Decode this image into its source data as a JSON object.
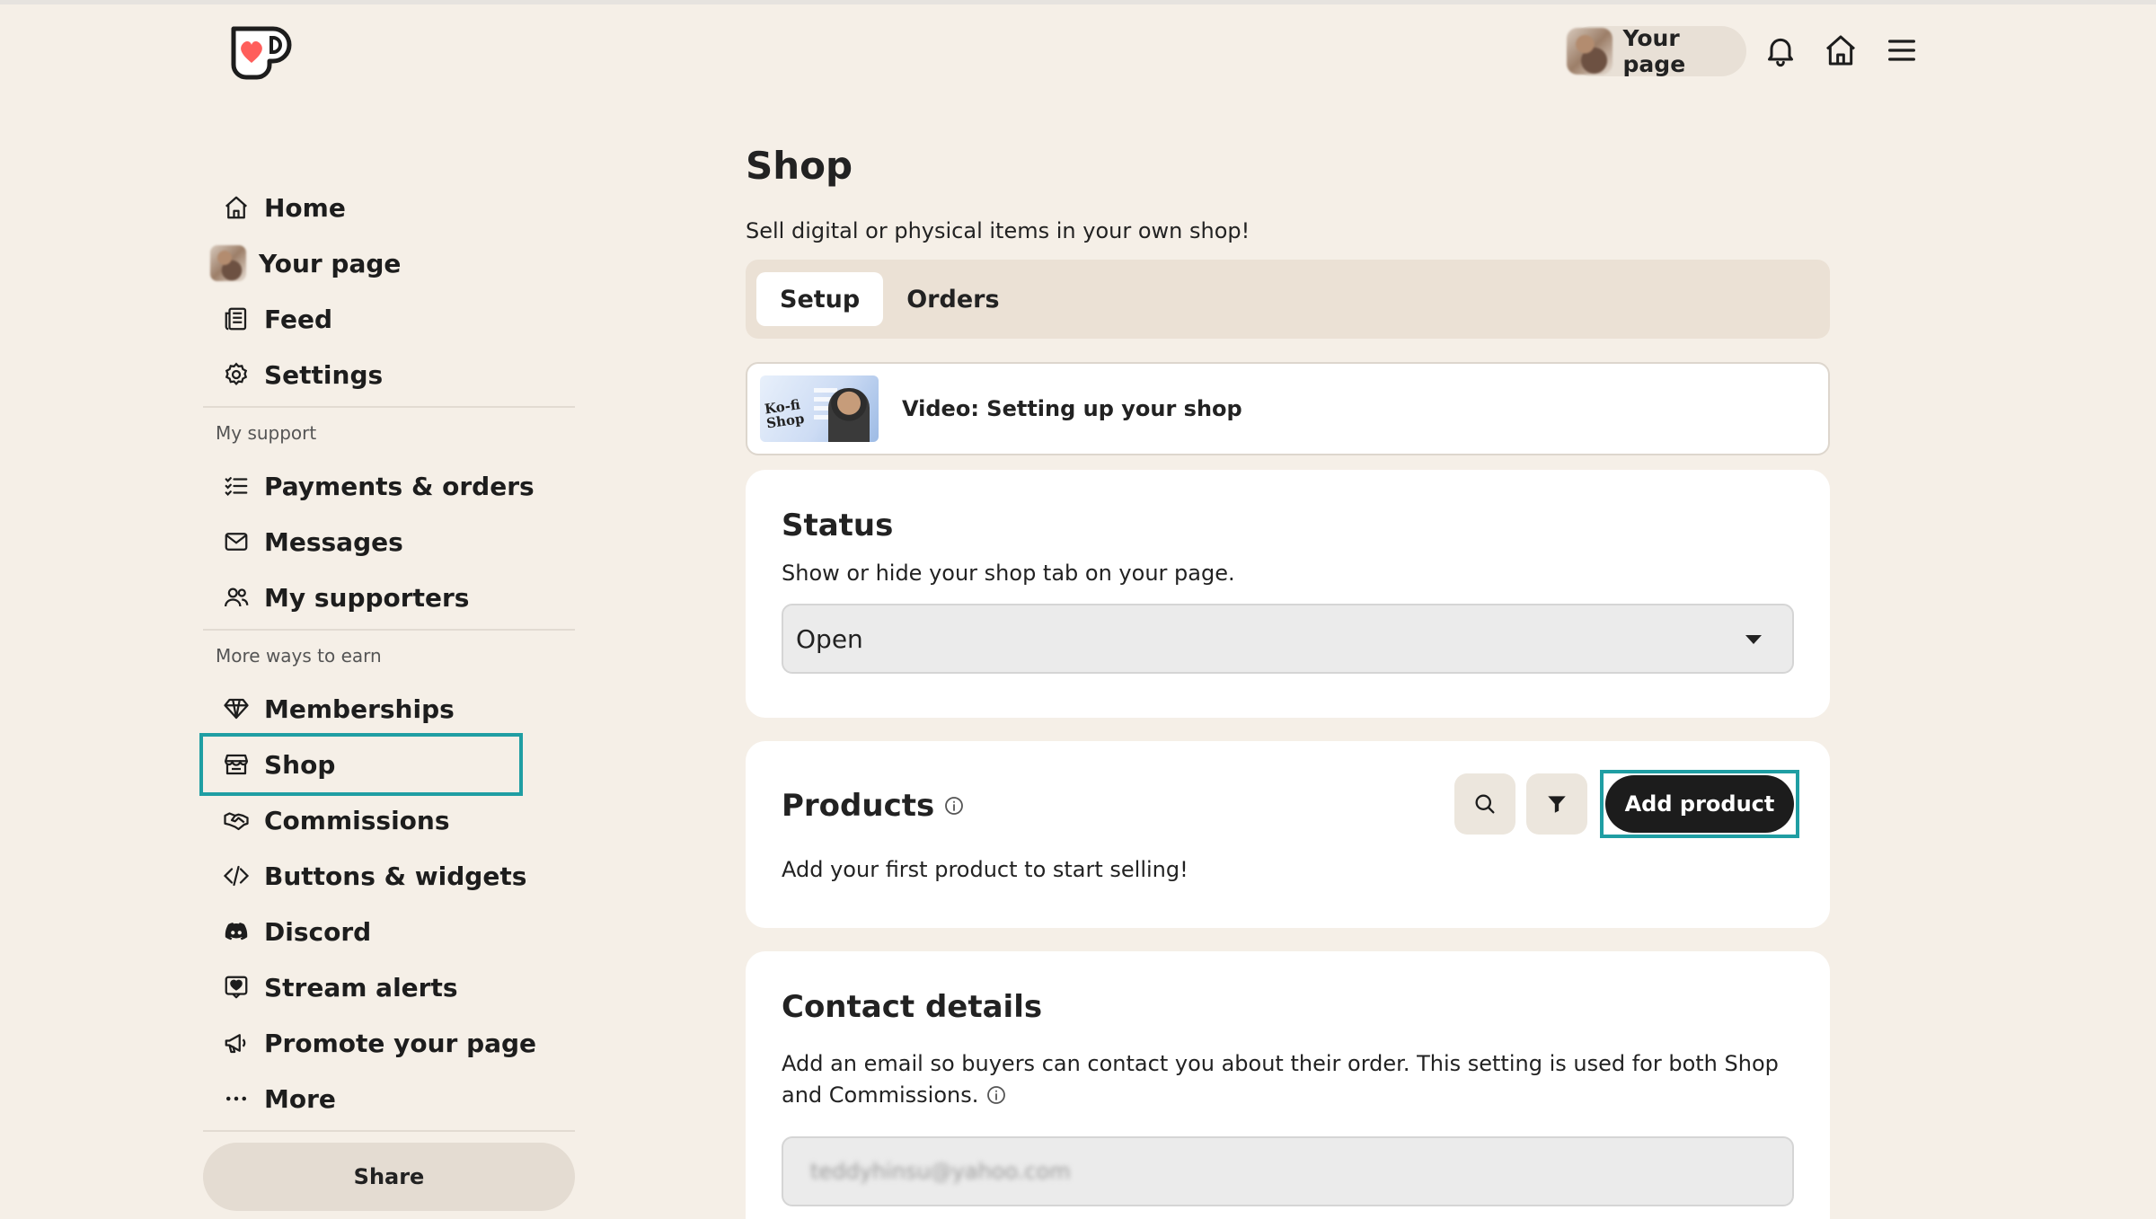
{
  "header": {
    "your_page_label": "Your page"
  },
  "sidebar": {
    "items_top": [
      {
        "label": "Home",
        "icon": "home-icon"
      },
      {
        "label": "Your page",
        "icon": "avatar"
      },
      {
        "label": "Feed",
        "icon": "feed-icon"
      },
      {
        "label": "Settings",
        "icon": "gear-icon"
      }
    ],
    "section_support": "My support",
    "items_support": [
      {
        "label": "Payments & orders",
        "icon": "list-check-icon"
      },
      {
        "label": "Messages",
        "icon": "envelope-icon"
      },
      {
        "label": "My supporters",
        "icon": "users-icon"
      }
    ],
    "section_earn": "More ways to earn",
    "items_earn": [
      {
        "label": "Memberships",
        "icon": "diamond-icon"
      },
      {
        "label": "Shop",
        "icon": "store-icon"
      },
      {
        "label": "Commissions",
        "icon": "handshake-icon"
      },
      {
        "label": "Buttons & widgets",
        "icon": "code-icon"
      },
      {
        "label": "Discord",
        "icon": "discord-icon"
      },
      {
        "label": "Stream alerts",
        "icon": "alert-icon"
      },
      {
        "label": "Promote your page",
        "icon": "megaphone-icon"
      },
      {
        "label": "More",
        "icon": "ellipsis-icon"
      }
    ],
    "share_label": "Share"
  },
  "main": {
    "title": "Shop",
    "subtitle": "Sell digital or physical items in your own shop!",
    "tabs": [
      {
        "label": "Setup"
      },
      {
        "label": "Orders"
      }
    ],
    "video": {
      "thumb_text": "Ko-fi Shop",
      "title": "Video: Setting up your shop"
    },
    "status": {
      "heading": "Status",
      "description": "Show or hide your shop tab on your page.",
      "selected": "Open"
    },
    "products": {
      "heading": "Products",
      "add_label": "Add product",
      "empty_text": "Add your first product to start selling!"
    },
    "contact": {
      "heading": "Contact details",
      "description": "Add an email so buyers can contact you about their order. This setting is used for both Shop and Commissions.",
      "email_value": "teddyhinsu@yahoo.com"
    }
  },
  "colors": {
    "background": "#f5efe7",
    "highlight": "#1f9ea3",
    "logo_red": "#ff5e5b"
  }
}
